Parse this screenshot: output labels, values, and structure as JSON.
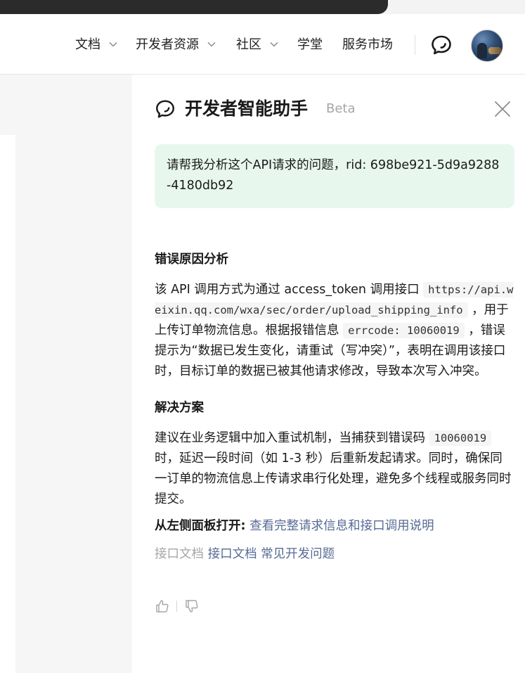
{
  "header": {
    "nav": [
      {
        "label": "文档",
        "has_dropdown": true
      },
      {
        "label": "开发者资源",
        "has_dropdown": true
      },
      {
        "label": "社区",
        "has_dropdown": true
      },
      {
        "label": "学堂",
        "has_dropdown": false
      },
      {
        "label": "服务市场",
        "has_dropdown": false
      }
    ],
    "icons": {
      "assistant": "chat-bubble-icon",
      "dropdown": "chevron-down-icon"
    }
  },
  "panel": {
    "title": "开发者智能助手",
    "badge": "Beta",
    "icons": {
      "title": "chat-bubble-icon",
      "close": "close-icon"
    },
    "user_message": "请帮我分析这个API请求的问题，rid: 698be921-5d9a9288-4180db92",
    "answer": {
      "section1_title": "错误原因分析",
      "s1_text1": "该 API 调用方式为通过 access_token 调用接口 ",
      "s1_code1": "https://api.weixin.qq.com/wxa/sec/order/upload_shipping_info",
      "s1_text2": " ，用于上传订单物流信息。根据报错信息 ",
      "s1_code2": "errcode: 10060019",
      "s1_text3": " ，错误提示为“数据已发生变化，请重试（写冲突）”，表明在调用该接口时，目标订单的数据已被其他请求修改，导致本次写入冲突。",
      "section2_title": "解决方案",
      "s2_text1": "建议在业务逻辑中加入重试机制，当捕获到错误码 ",
      "s2_code1": "10060019",
      "s2_text2": " 时，延迟一段时间（如 1-3 秒）后重新发起请求。同时，确保同一订单的物流信息上传请求串行化处理，避免多个线程或服务同时提交。",
      "open_lead": "从左侧面板打开:",
      "open_link": "查看完整请求信息和接口调用说明",
      "refs_muted": "接口文档",
      "refs_links": [
        "接口文档",
        "常见开发问题"
      ]
    },
    "feedback": {
      "like": "thumbs-up-icon",
      "dislike": "thumbs-down-icon"
    }
  },
  "colors": {
    "accent_link": "#576b95",
    "user_bubble_bg": "#e8f7ee",
    "muted_text": "#a6a6a6",
    "left_background": "#f6f6f6"
  }
}
